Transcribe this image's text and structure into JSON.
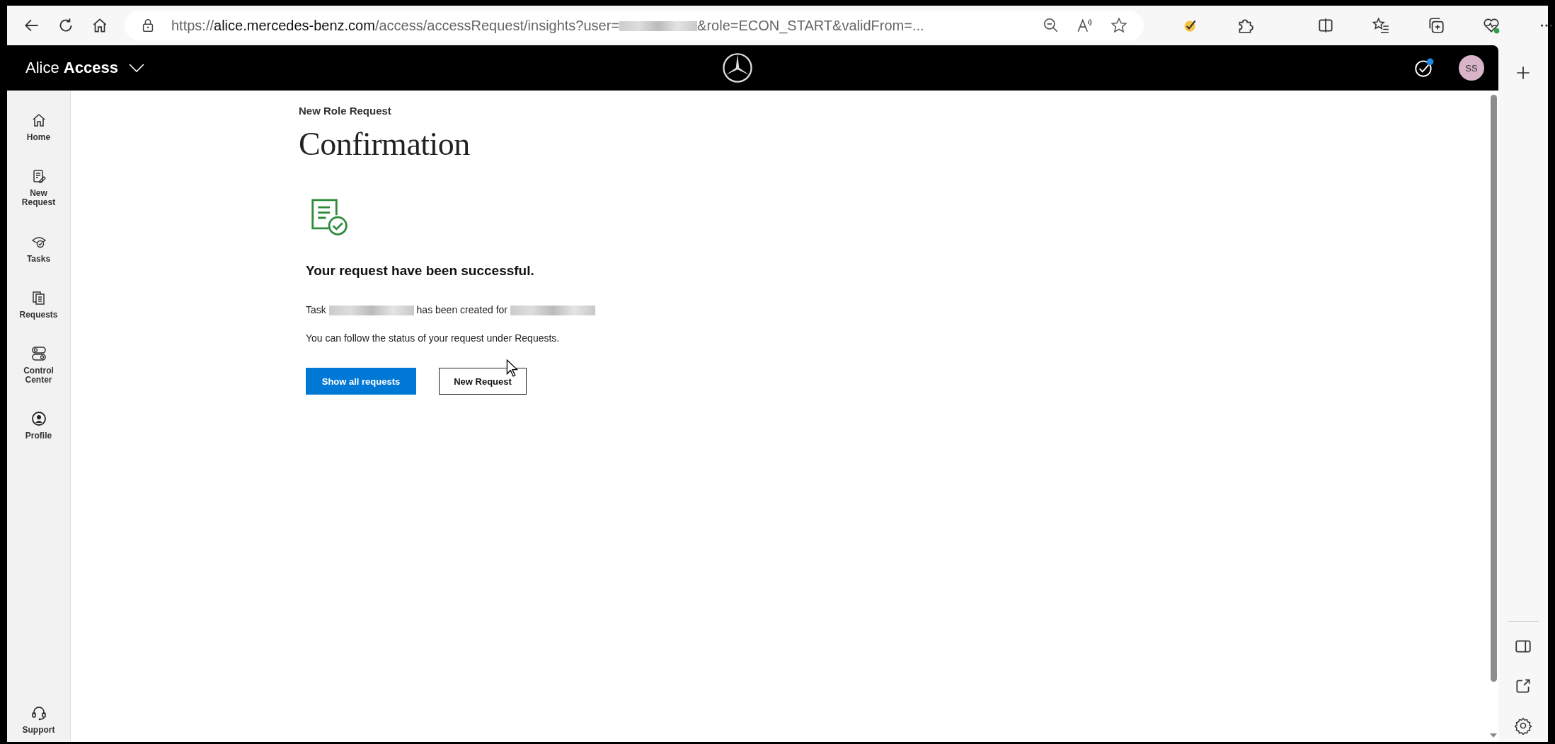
{
  "browser": {
    "url_scheme": "https://",
    "url_host": "alice.mercedes-benz.com",
    "url_path": "/access/accessRequest/insights?user=",
    "url_end": "&role=ECON_START&validFrom=..."
  },
  "header": {
    "app_name": "Alice **Access**",
    "avatar": "SS",
    "notification_dot": true
  },
  "sidebar": {
    "items": [
      {
        "kind": "home",
        "label": "Home"
      },
      {
        "kind": "new",
        "label": "New Request"
      },
      {
        "kind": "tasks",
        "label": "Tasks"
      },
      {
        "kind": "requests",
        "label": "Requests"
      },
      {
        "kind": "control",
        "label": "Control Center"
      },
      {
        "kind": "profile",
        "label": "Profile"
      }
    ],
    "footer": {
      "kind": "support",
      "label": "Support"
    }
  },
  "page": {
    "breadcrumb": "New Role Request",
    "title": "Confirmation",
    "heading": "Your request have been successful.",
    "task_message": [
      {
        "kind": "text",
        "text": "Task"
      },
      {
        "kind": "redacted"
      },
      {
        "kind": "text",
        "text": "has been created for"
      },
      {
        "kind": "redacted"
      }
    ],
    "follow_message": "You can follow the status of your request under Requests.",
    "buttons": [
      {
        "kind": "primary",
        "label": "Show all requests"
      },
      {
        "kind": "secondary",
        "label": "New Request"
      }
    ]
  }
}
